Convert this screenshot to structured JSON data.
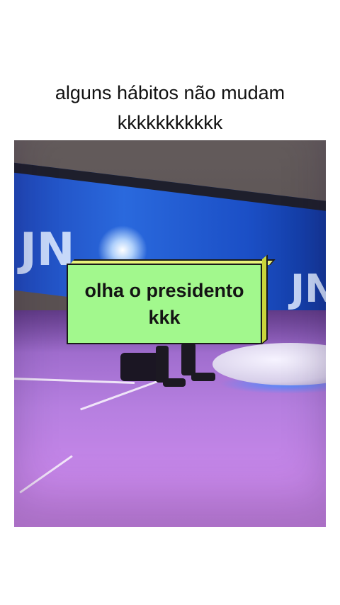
{
  "caption": {
    "line1": "alguns hábitos não mudam",
    "line2": "kkkkkkkkkkk"
  },
  "sticker": {
    "line1": "olha o presidento",
    "line2": "kkk"
  },
  "video": {
    "screen_letters": [
      "JN",
      "JN"
    ]
  }
}
